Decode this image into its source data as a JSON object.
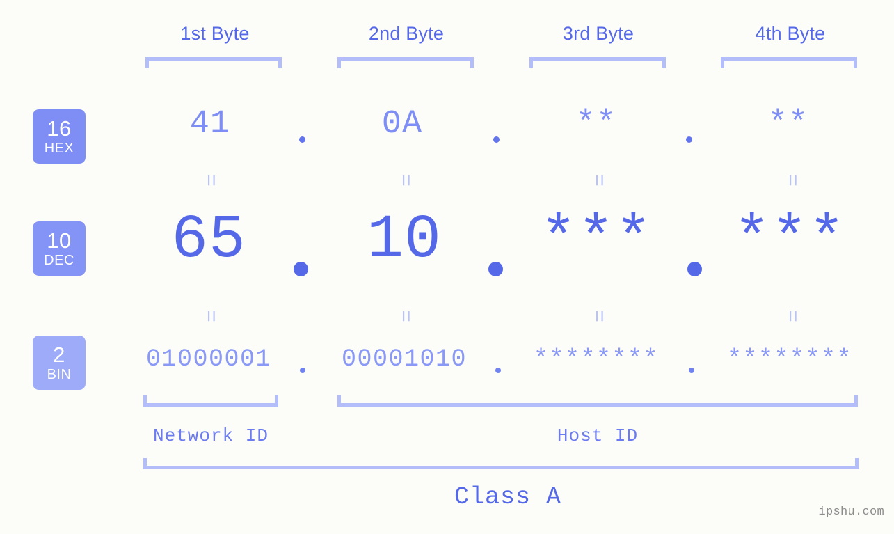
{
  "watermark": "ipshu.com",
  "byte_headers": [
    {
      "label": "1st Byte"
    },
    {
      "label": "2nd Byte"
    },
    {
      "label": "3rd Byte"
    },
    {
      "label": "4th Byte"
    }
  ],
  "bases": [
    {
      "number": "16",
      "abbr": "HEX",
      "color": "#7f8ef5"
    },
    {
      "number": "10",
      "abbr": "DEC",
      "color": "#8493f6"
    },
    {
      "number": "2",
      "abbr": "BIN",
      "color": "#9dabf9"
    }
  ],
  "rows": {
    "hex": {
      "base_number": "16",
      "base_abbr": "HEX",
      "values": [
        "41",
        "0A",
        "**",
        "**"
      ],
      "separator": "."
    },
    "dec": {
      "base_number": "10",
      "base_abbr": "DEC",
      "values": [
        "65",
        "10",
        "***",
        "***"
      ],
      "separator": "."
    },
    "bin": {
      "base_number": "2",
      "base_abbr": "BIN",
      "values": [
        "01000001",
        "00001010",
        "********",
        "********"
      ],
      "separator": "."
    }
  },
  "equals_sign": "=",
  "segments": {
    "network_id": "Network ID",
    "host_id": "Host ID",
    "class": "Class A"
  },
  "colors": {
    "background": "#fcfdf8",
    "accent_strong": "#5569e8",
    "accent_mid": "#7f8ef5",
    "accent_light": "#b3bdf9",
    "watermark": "#8d8d8d"
  }
}
